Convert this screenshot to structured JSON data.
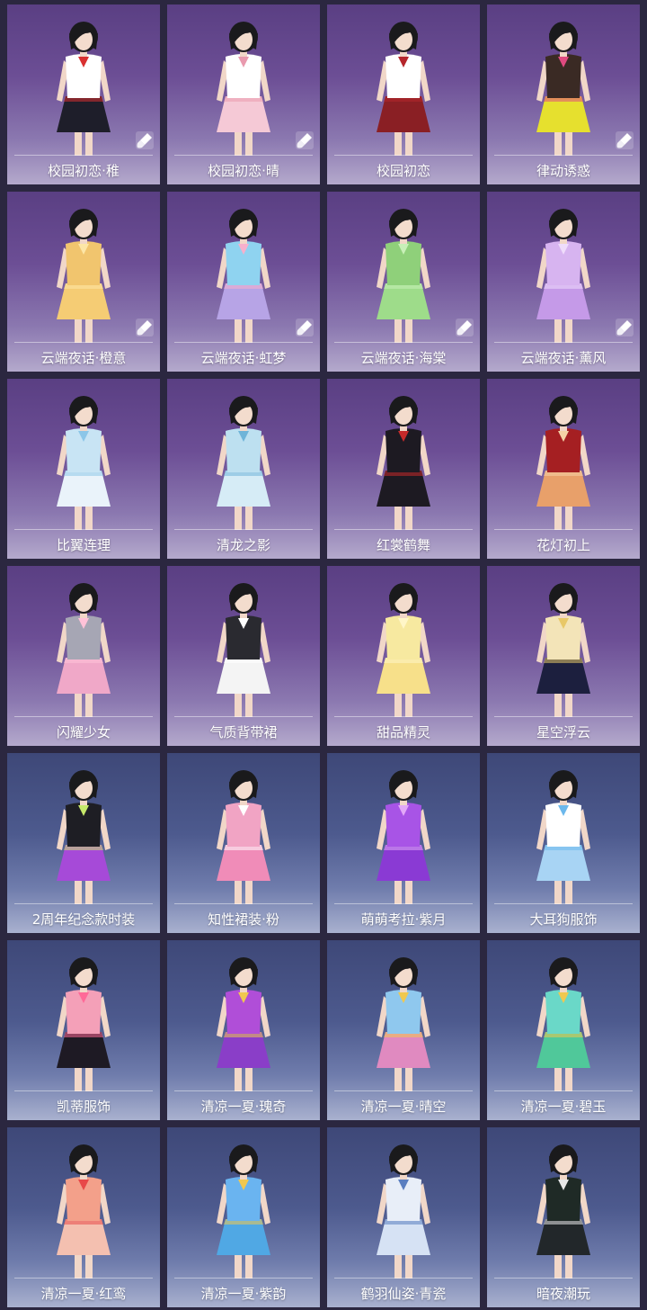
{
  "items": [
    {
      "name": "校园初恋·稚",
      "theme": "purple",
      "top": "#ffffff",
      "bottom": "#1e1e2a",
      "accent": "#d93030",
      "hair": "#1a1a1c",
      "brush": true
    },
    {
      "name": "校园初恋·晴",
      "theme": "purple",
      "top": "#ffffff",
      "bottom": "#f5c9d6",
      "accent": "#e99aae",
      "hair": "#1a1a1c",
      "brush": true
    },
    {
      "name": "校园初恋",
      "theme": "purple",
      "top": "#ffffff",
      "bottom": "#8a1f24",
      "accent": "#b5262c",
      "hair": "#1a1a1c",
      "brush": false
    },
    {
      "name": "律动诱惑",
      "theme": "purple",
      "top": "#3a2a24",
      "bottom": "#e6e02e",
      "accent": "#e04a80",
      "hair": "#1a1a1c",
      "brush": true
    },
    {
      "name": "云端夜话·橙意",
      "theme": "purple",
      "top": "#f1c56e",
      "bottom": "#f5cc74",
      "accent": "#fde6a6",
      "hair": "#1a1a1c",
      "brush": true
    },
    {
      "name": "云端夜话·虹梦",
      "theme": "purple",
      "top": "#8fd3f0",
      "bottom": "#b7a4e6",
      "accent": "#f7b0cc",
      "hair": "#1a1a1c",
      "brush": true
    },
    {
      "name": "云端夜话·海棠",
      "theme": "purple",
      "top": "#8fd07a",
      "bottom": "#9edc8a",
      "accent": "#c8f0b8",
      "hair": "#1a1a1c",
      "brush": true
    },
    {
      "name": "云端夜话·薰风",
      "theme": "purple",
      "top": "#d7b4f0",
      "bottom": "#c59ae8",
      "accent": "#efdcfb",
      "hair": "#1a1a1c",
      "brush": true
    },
    {
      "name": "比翼连理",
      "theme": "purple",
      "top": "#c8e4f4",
      "bottom": "#eaf3fa",
      "accent": "#8cc6e8",
      "hair": "#1a1a1c",
      "brush": false
    },
    {
      "name": "清龙之影",
      "theme": "purple",
      "top": "#bde0f0",
      "bottom": "#d6ecf6",
      "accent": "#6fb4d8",
      "hair": "#1a1a1c",
      "brush": false
    },
    {
      "name": "红裳鹤舞",
      "theme": "purple",
      "top": "#1d1a22",
      "bottom": "#1d1a22",
      "accent": "#c62a2a",
      "hair": "#1a1a1c",
      "brush": false
    },
    {
      "name": "花灯初上",
      "theme": "purple",
      "top": "#a51f22",
      "bottom": "#e8a06a",
      "accent": "#f4d2a6",
      "hair": "#1a1a1c",
      "brush": false
    },
    {
      "name": "闪耀少女",
      "theme": "purple",
      "top": "#a6a6b4",
      "bottom": "#f0a8c8",
      "accent": "#ffc2d8",
      "hair": "#1a1a1c",
      "brush": false
    },
    {
      "name": "气质背带裙",
      "theme": "purple",
      "top": "#2a2a30",
      "bottom": "#f4f4f4",
      "accent": "#ffffff",
      "hair": "#1a1a1c",
      "brush": false
    },
    {
      "name": "甜品精灵",
      "theme": "purple",
      "top": "#f7e9a0",
      "bottom": "#f7e08a",
      "accent": "#fff6c8",
      "hair": "#1a1a1c",
      "brush": false
    },
    {
      "name": "星空浮云",
      "theme": "purple",
      "top": "#f3e4b8",
      "bottom": "#1c1f3e",
      "accent": "#e8c868",
      "hair": "#1a1a1c",
      "brush": false
    },
    {
      "name": "2周年纪念款时装",
      "theme": "blue",
      "top": "#1e1e24",
      "bottom": "#a64ad8",
      "accent": "#c6e86a",
      "hair": "#1a1a1c",
      "brush": false
    },
    {
      "name": "知性裙装·粉",
      "theme": "blue",
      "top": "#f1a4c4",
      "bottom": "#f08cb8",
      "accent": "#ffffff",
      "hair": "#1a1a1c",
      "brush": false
    },
    {
      "name": "萌萌考拉·紫月",
      "theme": "blue",
      "top": "#a854e6",
      "bottom": "#8a3ad4",
      "accent": "#e2a8f8",
      "hair": "#1a1a1c",
      "brush": false
    },
    {
      "name": "大耳狗服饰",
      "theme": "blue",
      "top": "#ffffff",
      "bottom": "#a8d4f4",
      "accent": "#6cb8ec",
      "hair": "#1a1a1c",
      "brush": false
    },
    {
      "name": "凯蒂服饰",
      "theme": "blue",
      "top": "#f4a0b8",
      "bottom": "#1e1a24",
      "accent": "#ff6a98",
      "hair": "#1a1a1c",
      "brush": false
    },
    {
      "name": "清凉一夏·瑰奇",
      "theme": "blue",
      "top": "#b04ed8",
      "bottom": "#8a3ec8",
      "accent": "#f0c850",
      "hair": "#1a1a1c",
      "brush": false
    },
    {
      "name": "清凉一夏·晴空",
      "theme": "blue",
      "top": "#8fc8ee",
      "bottom": "#e08ac0",
      "accent": "#f0c850",
      "hair": "#1a1a1c",
      "brush": false
    },
    {
      "name": "清凉一夏·碧玉",
      "theme": "blue",
      "top": "#6ad8c8",
      "bottom": "#50c89a",
      "accent": "#f0c850",
      "hair": "#1a1a1c",
      "brush": false
    },
    {
      "name": "清凉一夏·红鸾",
      "theme": "blue",
      "top": "#f3a08a",
      "bottom": "#f4c0b0",
      "accent": "#e84848",
      "hair": "#1a1a1c",
      "brush": false
    },
    {
      "name": "清凉一夏·紫韵",
      "theme": "blue",
      "top": "#6ab4f0",
      "bottom": "#50a8e4",
      "accent": "#f0c850",
      "hair": "#1a1a1c",
      "brush": false
    },
    {
      "name": "鹤羽仙姿·青瓷",
      "theme": "blue",
      "top": "#e8eef8",
      "bottom": "#d6e2f4",
      "accent": "#5a7ec0",
      "hair": "#1a1a1c",
      "brush": false
    },
    {
      "name": "暗夜潮玩",
      "theme": "blue",
      "top": "#1f2a26",
      "bottom": "#22272a",
      "accent": "#e8e8e8",
      "hair": "#1a1a1c",
      "brush": false
    }
  ]
}
